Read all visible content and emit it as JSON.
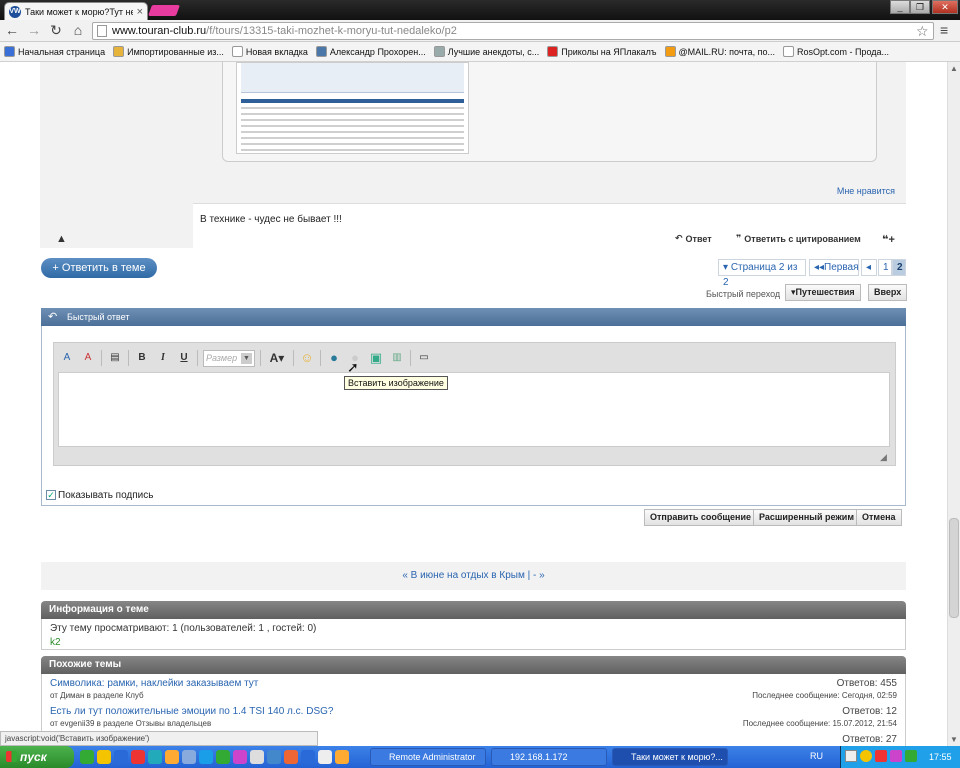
{
  "browser": {
    "tab_title": "Таки может к морю?Тут не",
    "favicon_text": "VW",
    "close_glyph": "×",
    "address_host": "www.touran-club.ru",
    "address_path": "/f/tours/13315-taki-mozhet-k-moryu-tut-nedaleko/p2",
    "star_glyph": "☆",
    "menu_glyph": "≡"
  },
  "bookmarks": [
    {
      "label": "Начальная страница",
      "icon": "google-icon",
      "color": "#3b6fd8"
    },
    {
      "label": "Импортированные из...",
      "icon": "folder-icon",
      "color": "#e7b43b"
    },
    {
      "label": "Новая вкладка",
      "icon": "page-icon",
      "color": "#ffffff"
    },
    {
      "label": "Александр Прохорен...",
      "icon": "vk-icon",
      "color": "#4a76a8"
    },
    {
      "label": "Лучшие анекдоты, с...",
      "icon": "star-icon",
      "color": "#9aa"
    },
    {
      "label": "Приколы на ЯПлакалъ",
      "icon": "red-icon",
      "color": "#d22"
    },
    {
      "label": "@MAIL.RU: почта, по...",
      "icon": "mail-icon",
      "color": "#f39c12"
    },
    {
      "label": "RosOpt.com - Прода...",
      "icon": "page-icon",
      "color": "#ffffff"
    }
  ],
  "post": {
    "like_text": "Мне нравится",
    "body_text": "В технике - чудес не бывает !!!",
    "reply_label": "Ответ",
    "quote_label": "Ответить с цитированием"
  },
  "controls": {
    "reply_theme": "+ Ответить в теме",
    "page_dropdown": "Страница 2 из 2",
    "first_label": "Первая",
    "prev_glyph": "◂",
    "pages": [
      "1",
      "2"
    ],
    "current_page": "2",
    "quick_nav_label": "Быстрый переход",
    "quick_nav_value": "Путешествия",
    "top_button": "Вверх"
  },
  "quick_reply": {
    "title": "Быстрый ответ",
    "size_placeholder": "Размер",
    "tooltip": "Вставить изображение",
    "show_signature": "Показывать подпись",
    "submit": "Отправить сообщение",
    "advanced": "Расширенный режим",
    "cancel": "Отмена"
  },
  "bottom_nav": {
    "text": "« В июне на отдых в Крым | - »"
  },
  "info_block": {
    "title": "Информация о теме",
    "viewing": "Эту тему просматривают: 1 (пользователей: 1 , гостей: 0)",
    "user": "k2"
  },
  "similar_block": {
    "title": "Похожие темы",
    "items": [
      {
        "title": "Символика: рамки, наклейки заказываем тут",
        "meta": "от Диман в разделе Клуб",
        "replies": "Ответов: 455",
        "last": "Последнее сообщение: Сегодня, 02:59"
      },
      {
        "title": "Есть ли тут положительные эмоции по 1.4 TSI 140 л.с. DSG?",
        "meta": "от evgenii39 в разделе Отзывы владельцев",
        "replies": "Ответов: 12",
        "last": "Последнее сообщение: 15.07.2012, 21:54"
      },
      {
        "title": "",
        "meta": "",
        "replies": "Ответов: 27",
        "last": ""
      }
    ]
  },
  "status_bar": "javascript:void('Вставить изображение')",
  "taskbar": {
    "start": "пуск",
    "tasks": [
      "Remote Administrator",
      "192.168.1.172",
      "Таки может к морю?..."
    ],
    "lang": "RU",
    "clock": "17:55"
  }
}
